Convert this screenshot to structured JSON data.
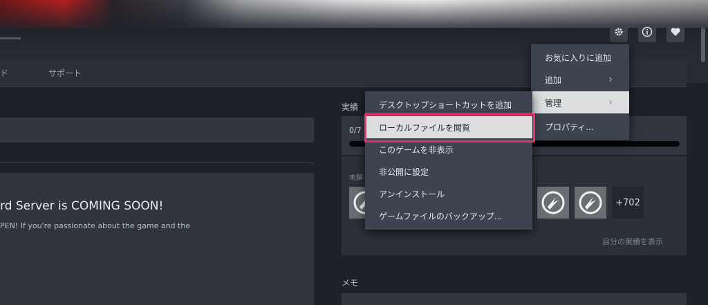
{
  "colors": {
    "background": "#1e2128",
    "menu_bg": "#3d4450",
    "menu_highlight": "#dcdedf",
    "annotation_outline": "#e8336d"
  },
  "header_icons": [
    "gear-icon",
    "info-icon",
    "heart-icon"
  ],
  "nav": {
    "partial_item": "ド",
    "support": "サポート"
  },
  "news": {
    "title": "rd Server is COMING SOON!",
    "body": "PEN! If you're passionate about the game and the"
  },
  "achievements": {
    "label": "実績",
    "count": "0/7",
    "progress": 0,
    "locked_label": "未解",
    "more": "+702",
    "show_link": "自分の実績を表示"
  },
  "memo": {
    "label": "メモ"
  },
  "context_menu": {
    "items": [
      {
        "label": "お気に入りに追加"
      },
      {
        "label": "追加",
        "chevron": "›"
      },
      {
        "label": "管理",
        "chevron": "›"
      },
      {
        "label": "プロパティ..."
      }
    ]
  },
  "submenu": {
    "items": [
      {
        "label": "デスクトップショートカットを追加"
      },
      {
        "label": "ローカルファイルを閲覧"
      },
      {
        "label": "このゲームを非表示"
      },
      {
        "label": "非公開に設定"
      },
      {
        "label": "アンインストール"
      },
      {
        "label": "ゲームファイルのバックアップ..."
      }
    ]
  }
}
